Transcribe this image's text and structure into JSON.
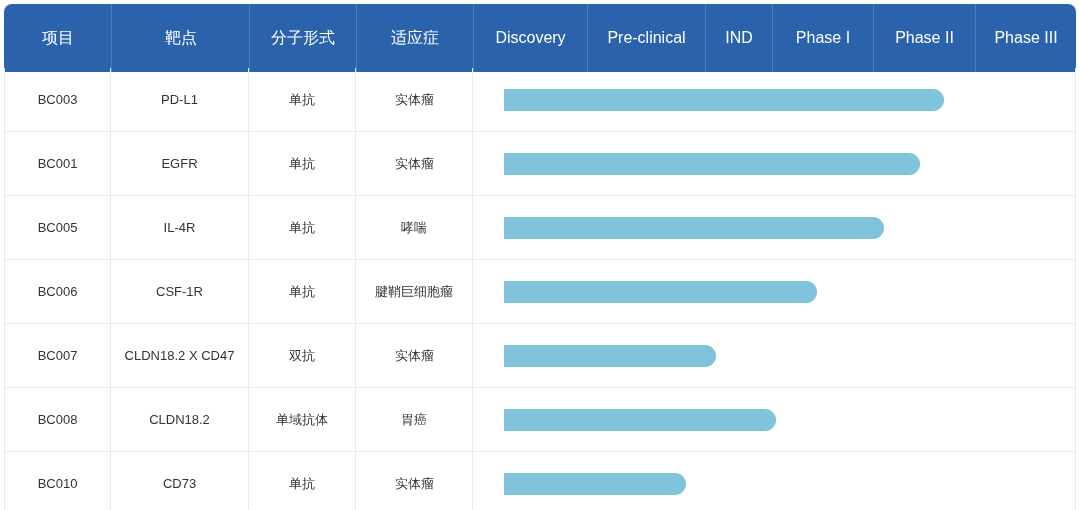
{
  "table": {
    "columns": [
      "项目",
      "靶点",
      "分子形式",
      "适应症",
      "Discovery",
      "Pre-clinical",
      "IND",
      "Phase I",
      "Phase II",
      "Phase III"
    ],
    "rows": [
      {
        "project": "BC003",
        "target": "PD-L1",
        "format": "单抗",
        "indication": "实体瘤",
        "level": 0.771
      },
      {
        "project": "BC001",
        "target": "EGFR",
        "format": "单抗",
        "indication": "实体瘤",
        "level": 0.729
      },
      {
        "project": "BC005",
        "target": "IL-4R",
        "format": "单抗",
        "indication": "哮喘",
        "level": 0.666
      },
      {
        "project": "BC006",
        "target": "CSF-1R",
        "format": "单抗",
        "indication": "腱鞘巨细胞瘤",
        "level": 0.549
      },
      {
        "project": "BC007",
        "target": "CLDN18.2 X CD47",
        "format": "双抗",
        "indication": "实体瘤",
        "level": 0.371
      },
      {
        "project": "BC008",
        "target": "CLDN18.2",
        "format": "单域抗体",
        "indication": "胃癌",
        "level": 0.476
      },
      {
        "project": "BC010",
        "target": "CD73",
        "format": "单抗",
        "indication": "实体瘤",
        "level": 0.318
      }
    ]
  }
}
